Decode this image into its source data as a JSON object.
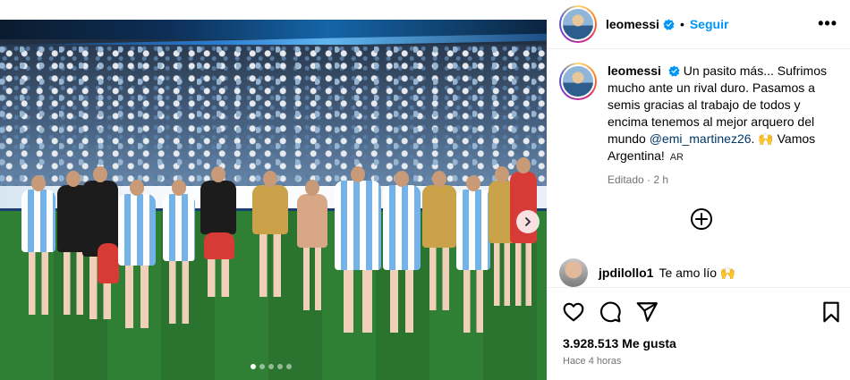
{
  "post": {
    "username": "leomessi",
    "follow_label": "Seguir",
    "separator": "•",
    "more_label": "•••",
    "caption": {
      "text_before_mention": "Un pasito más... Sufrimos mucho ante un rival duro. Pasamos a semis gracias al trabajo de todos y encima tenemos al mejor arquero del mundo",
      "mention": "@emi_martinez26",
      "text_after_mention": ". 🙌 Vamos Argentina!",
      "lang_tag": "AR"
    },
    "edited_label": "Editado · 2 h",
    "carousel": {
      "slide_count": 5,
      "active_index": 0
    },
    "comment": {
      "username": "jpdilollo1",
      "text": "Te amo lío 🙌"
    },
    "likes_label": "3.928.513 Me gusta",
    "timestamp_label": "Hace 4 horas"
  },
  "icons": {
    "verified": "verified-badge-icon",
    "more": "more-options-icon",
    "add_comment": "add-circle-icon",
    "like": "heart-icon",
    "comment": "comment-bubble-icon",
    "share": "paper-plane-icon",
    "save": "bookmark-icon",
    "next": "chevron-right-icon"
  },
  "colors": {
    "link_blue": "#0095f6",
    "mention": "#00376b",
    "muted": "#737373",
    "verified": "#0095f6"
  }
}
